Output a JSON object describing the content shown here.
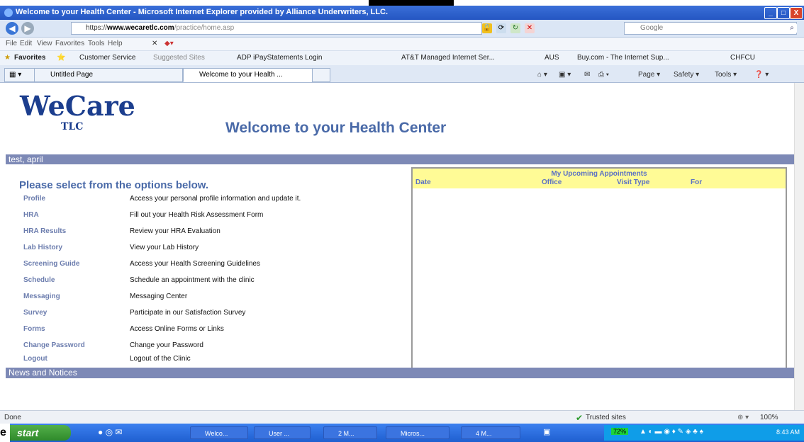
{
  "window": {
    "title": "Welcome to your Health Center - Microsoft Internet Explorer provided by Alliance Underwriters, LLC.",
    "buttons": [
      "_",
      "□",
      "X"
    ]
  },
  "address": {
    "url_scheme": "https://",
    "url_domain": "www.wecaretlc.com",
    "url_path": "/practice/home.asp",
    "search_placeholder": "Google"
  },
  "menu": [
    "File",
    "Edit",
    "View",
    "Favorites",
    "Tools",
    "Help"
  ],
  "favorites": {
    "label": "Favorites",
    "items": [
      "Customer Service",
      "Suggested Sites",
      "ADP iPayStatements Login",
      "AT&T Managed Internet Ser...",
      "AUS",
      "Buy.com - The Internet Sup...",
      "CHFCU"
    ]
  },
  "tabs": [
    {
      "label": "Untitled Page"
    },
    {
      "label": "Welcome to your Health ..."
    }
  ],
  "commands": [
    "Page",
    "Safety",
    "Tools"
  ],
  "page": {
    "logo": {
      "we": "We",
      "care": "Care",
      "tlc": "TLC"
    },
    "welcome": "Welcome to your Health Center",
    "user": "test, april",
    "select_heading": "Please select from the options below.",
    "options": [
      {
        "link": "Profile",
        "desc": "Access your personal profile information and update it."
      },
      {
        "link": "HRA",
        "desc": "Fill out your Health Risk Assessment Form"
      },
      {
        "link": "HRA Results",
        "desc": "Review your HRA Evaluation"
      },
      {
        "link": "Lab History",
        "desc": "View your Lab History"
      },
      {
        "link": "Screening Guide",
        "desc": "Access your Health Screening Guidelines"
      },
      {
        "link": "Schedule",
        "desc": "Schedule an appointment with the clinic"
      },
      {
        "link": "Messaging",
        "desc": "Messaging Center"
      },
      {
        "link": "Survey",
        "desc": "Participate in our Satisfaction Survey"
      },
      {
        "link": "Forms",
        "desc": "Access Online Forms or Links"
      },
      {
        "link": "Change Password",
        "desc": "Change your Password"
      },
      {
        "link": "Logout",
        "desc": "Logout of the Clinic"
      }
    ],
    "appointments": {
      "title": "My Upcoming Appointments",
      "columns": [
        "Date",
        "Office",
        "Visit Type",
        "For"
      ]
    },
    "news": "News and Notices"
  },
  "status": {
    "text": "Done",
    "trusted": "Trusted sites",
    "zoom": "100%"
  },
  "taskbar": {
    "start": "start",
    "buttons": [
      "Welco...",
      "User ...",
      "2 M...",
      "Micros...",
      "4 M..."
    ],
    "battery": "72%",
    "clock": "8:43 AM"
  },
  "colors": {
    "accent": "#4a6aa8",
    "bar": "#7d89b6",
    "appt_head": "#fffb96"
  }
}
